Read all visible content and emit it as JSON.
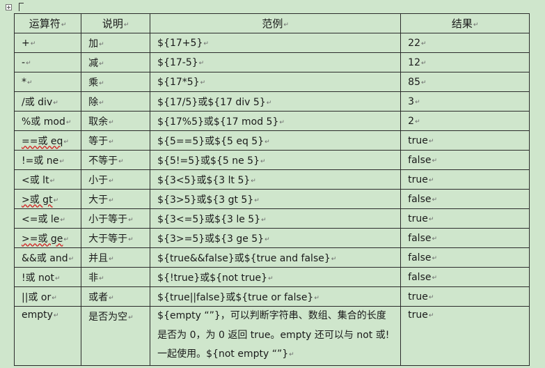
{
  "table": {
    "headers": [
      "运算符",
      "说明",
      "范例",
      "结果"
    ],
    "rows": [
      {
        "op": "+",
        "desc": "加",
        "example": "${17+5}",
        "result": "22"
      },
      {
        "op": "-",
        "desc": "减",
        "example": "${17-5}",
        "result": "12"
      },
      {
        "op": "*",
        "desc": "乘",
        "example": "${17*5}",
        "result": "85"
      },
      {
        "op": "/或 div",
        "desc": "除",
        "example": "${17/5}或${17 div 5}",
        "result": "3"
      },
      {
        "op": "%或 mod",
        "desc": "取余",
        "example": "${17%5}或${17 mod 5}",
        "result": "2"
      },
      {
        "op": "==或 eq",
        "desc": "等于",
        "example": "${5==5}或${5 eq 5}",
        "result": "true"
      },
      {
        "op": "!=或 ne",
        "desc": "不等于",
        "example": "${5!=5}或${5 ne 5}",
        "result": "false"
      },
      {
        "op": "<或 lt",
        "desc": "小于",
        "example": "${3<5}或${3 lt 5}",
        "result": "true"
      },
      {
        "op": ">或 gt",
        "desc": "大于",
        "example": "${3>5}或${3 gt 5}",
        "result": "false"
      },
      {
        "op": "<=或 le",
        "desc": "小于等于",
        "example": "${3<=5}或${3 le 5}",
        "result": "true"
      },
      {
        "op": ">=或 ge",
        "desc": "大于等于",
        "example": "${3>=5}或${3 ge 5}",
        "result": "false"
      },
      {
        "op": "&&或 and",
        "desc": "并且",
        "example": "${true&&false}或${true and false}",
        "result": "false"
      },
      {
        "op": "!或 not",
        "desc": "非",
        "example": "${!true}或${not true}",
        "result": "false"
      },
      {
        "op": "||或 or",
        "desc": "或者",
        "example": "${true||false}或${true or false}",
        "result": "true"
      },
      {
        "op": "empty",
        "desc": "是否为空",
        "example": "${empty “”}，可以判断字符串、数组、集合的长度是否为 0，为 0 返回 true。empty 还可以与 not 或!一起使用。${not empty “”}",
        "result": "true"
      }
    ]
  },
  "marks": {
    "paragraph_mark": "↵",
    "accent_color": "#cfe6cc"
  }
}
